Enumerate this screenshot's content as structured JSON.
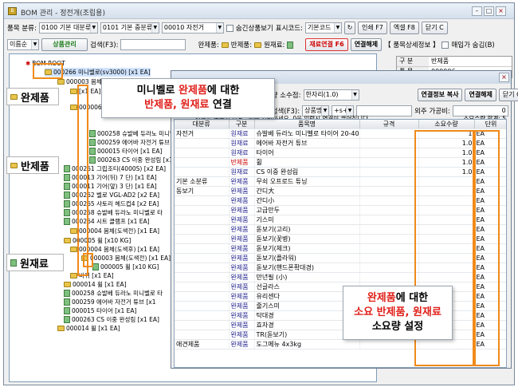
{
  "window": {
    "title": "BOM 관리 - 정전개(조립용)",
    "icon": "bom-app-icon"
  },
  "toolbar1": {
    "class_label": "품목 분류:",
    "class1": "0100 기본 대분류",
    "class2": "0101 기본 중분류",
    "class3": "00010 자전거",
    "hide_label": "숨긴상품보기",
    "barcode_label": "표시코드:",
    "barcode_value": "기본코드",
    "print_label": "인쇄 F7",
    "excel_label": "엑셀 F8",
    "close_label": "닫기 C"
  },
  "toolbar2": {
    "sort_value": "이름순",
    "product_mgmt": "상품관리",
    "search_label": "검색(F3):",
    "legend_finished": "완제품:",
    "legend_semi": "반제품:",
    "legend_raw": "원재료:",
    "material_link": "재료연결 F6",
    "unlink": "연결해제",
    "detail_label": "【 품목상세정보 】",
    "buy_hide": "매입가 숨김(B)"
  },
  "tree": {
    "root": "BOM ROOT",
    "nodes": [
      "000266 미니벨로(sv3000) [x1 EA]",
      "000003 몸체(도색전) [x1 EA]",
      "[x1 EA]",
      "000006 바퀴 [x1 EA]",
      "000258 슈발베 듀라노 미니벨로 타",
      "000259 에어바 자전거 튜브",
      "000015 타이어 [x1 EA]",
      "000263 CS 이중 완성림 [x1",
      "000261 그립조티(4000S) [x2 EA]",
      "000013 기어(뒤) 7 단) [x1 EA]",
      "000011 기어(앞) 3 단) [x1 EA]",
      "000262 벨로 VGL-AD2 [x2 EA]",
      "000265 샤토리 헤드컵4 [x2 EA]",
      "000258 슈발베 듀라노 미니벨로 타",
      "000264 시트 클램프 [x1 EA]",
      "000004 몸체(도색전) [x1 EA]",
      "000005 휠 [x10 KG]",
      "000004 몸체(도색후) [x1 EA]",
      "000003 몸체(도색전) [x1 EA]",
      "000005 휠 [x10 KG]",
      "바퀴 [x1 EA]",
      "000014 휠 [x1 EA]",
      "000258 슈발베 듀라노 미니벨로 타",
      "000259 에어바 자전거 튜브 [x1",
      "000015 타이어 [x1 EA]",
      "000263 CS 이중 완성림 [x1 EA]",
      "000014 휠 [x1 EA]"
    ]
  },
  "right_panel": {
    "col1": "구 분",
    "col2": "반제품",
    "r1": "품 목",
    "r2": "000006"
  },
  "popup": {
    "type_label": "요수량 소수점:",
    "type_value": "한자리(1.0)",
    "copy_btn": "연결정보 복사",
    "unlink_btn": "연결해제",
    "close_btn": "닫기 C",
    "search_label": "상품검색(F3):",
    "search_mode": "상품명",
    "search_plus": "+s+",
    "buy_label": "외주 가공비:",
    "buy_value": "0",
    "hint": "연결할 품목의 소요수량을 입력하세요, 0을 입력시 연결이 끊어집니다.",
    "count_label": "소요수량 합계: 5",
    "headers": [
      "대분류",
      "구분",
      "품목명",
      "규격",
      "소요수량",
      "단위"
    ],
    "rows": [
      [
        "자전거",
        "원재료",
        "슈발베 듀라노 미니벨로 타이어 20-406/451",
        "",
        "1",
        "EA"
      ],
      [
        "",
        "원재료",
        "에어바 자전거 튜브",
        "",
        "1.0",
        "EA"
      ],
      [
        "",
        "원재료",
        "타이어",
        "",
        "1.0",
        "EA"
      ],
      [
        "",
        "반제품",
        "휠",
        "",
        "1.0",
        "EA"
      ],
      [
        "",
        "원재료",
        "CS 이중 완성림",
        "",
        "1.0",
        "EA"
      ],
      [
        "기본 소분류",
        "완제품",
        "무쇠 오프로드 튜닝",
        "",
        "",
        "EA"
      ],
      [
        "동보기",
        "완제품",
        "간디大",
        "",
        "",
        "EA"
      ],
      [
        "",
        "완제품",
        "간디小",
        "",
        "",
        "EA"
      ],
      [
        "",
        "완제품",
        "고급만두",
        "",
        "",
        "EA"
      ],
      [
        "",
        "완제품",
        "기스미",
        "",
        "",
        "EA"
      ],
      [
        "",
        "완제품",
        "돋보기(고리)",
        "",
        "",
        "EA"
      ],
      [
        "",
        "완제품",
        "돋보기(꽃병)",
        "",
        "",
        "EA"
      ],
      [
        "",
        "완제품",
        "돋보기(체크)",
        "",
        "",
        "EA"
      ],
      [
        "",
        "완제품",
        "돋보기(플라워)",
        "",
        "",
        "EA"
      ],
      [
        "",
        "완제품",
        "돋보기(핸드폰확대경)",
        "",
        "",
        "EA"
      ],
      [
        "",
        "완제품",
        "만년필 (小)",
        "",
        "",
        "EA"
      ],
      [
        "",
        "완제품",
        "선글라스",
        "",
        "",
        "EA"
      ],
      [
        "",
        "완제품",
        "유리센다",
        "",
        "",
        "EA"
      ],
      [
        "",
        "완제품",
        "줄기스미",
        "",
        "",
        "EA"
      ],
      [
        "",
        "완제품",
        "탁대경",
        "",
        "",
        "EA"
      ],
      [
        "",
        "완제품",
        "효자경",
        "",
        "",
        "EA"
      ],
      [
        "",
        "완제품",
        "TR(돋보기)",
        "",
        "",
        "EA"
      ],
      [
        "애견제품",
        "완제품",
        "도그메뉴 4x3kg",
        "",
        "",
        "EA"
      ]
    ]
  },
  "annotations": {
    "callout1_a": "미니벨로 ",
    "callout1_b": "완제품",
    "callout1_c": "에 대한",
    "callout1_d": "반제품, 원재료",
    "callout1_e": " 연결",
    "label_finished": "완제품",
    "label_semi": "반제품",
    "label_raw": "원재료",
    "callout2_a": "완제품",
    "callout2_b": "에 대한",
    "callout2_c": "소요 반제품, 원재료",
    "callout2_d": "소요량 설정"
  }
}
